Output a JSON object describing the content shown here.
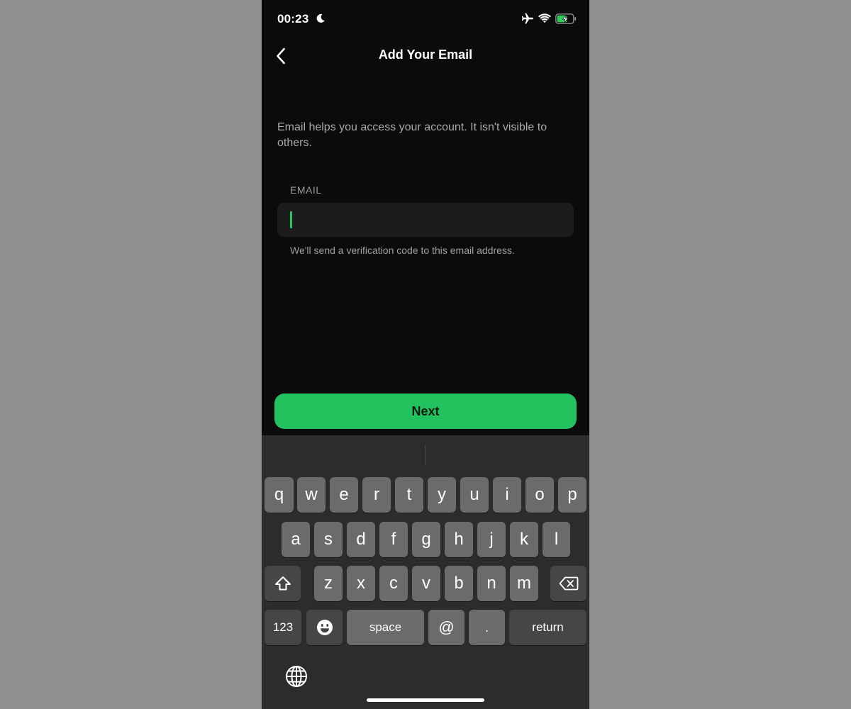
{
  "status_bar": {
    "time": "00:23",
    "icons": [
      "moon-icon",
      "airplane-icon",
      "wifi-icon",
      "battery-charging-icon"
    ]
  },
  "nav": {
    "back_icon": "chevron-left-icon",
    "title": "Add Your Email"
  },
  "description": "Email helps you access your account. It isn't visible to others.",
  "email_field": {
    "label": "EMAIL",
    "value": "",
    "placeholder": ""
  },
  "hint": "We'll send a verification code to this email address.",
  "next_button": {
    "label": "Next"
  },
  "colors": {
    "accent": "#22c25f",
    "background": "#0b0b0b",
    "keyboard": "#2c2c2d"
  },
  "keyboard": {
    "row1": [
      "q",
      "w",
      "e",
      "r",
      "t",
      "y",
      "u",
      "i",
      "o",
      "p"
    ],
    "row2": [
      "a",
      "s",
      "d",
      "f",
      "g",
      "h",
      "j",
      "k",
      "l"
    ],
    "row3": [
      "z",
      "x",
      "c",
      "v",
      "b",
      "n",
      "m"
    ],
    "numbers_key": "123",
    "space_key": "space",
    "at_key": "@",
    "dot_key": ".",
    "return_key": "return",
    "shift_icon": "shift-icon",
    "delete_icon": "delete-icon",
    "emoji_icon": "emoji-icon",
    "globe_icon": "globe-icon"
  }
}
